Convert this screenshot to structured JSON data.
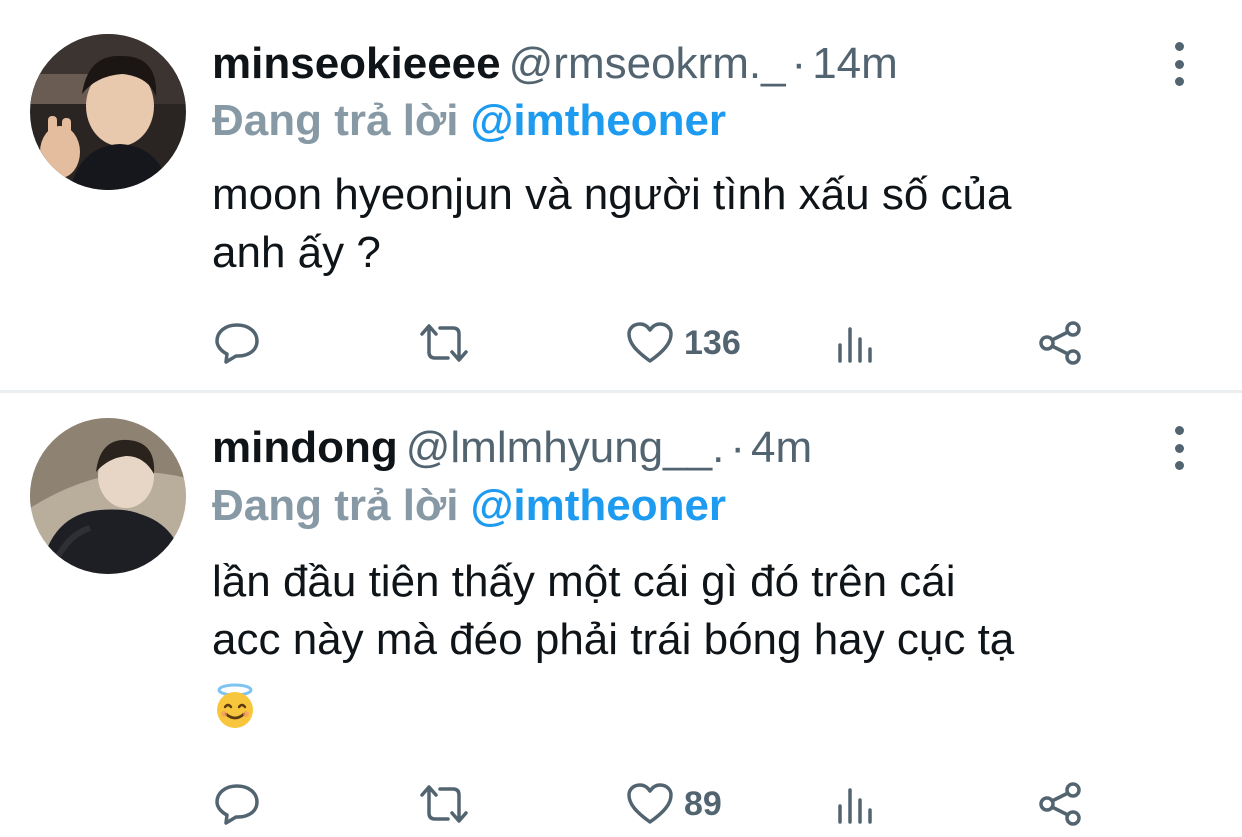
{
  "tweets": [
    {
      "display_name": "minseokieeee",
      "handle": "@rmseokrm._",
      "separator": "·",
      "time": "14m",
      "reply_label": "Đang trả lời",
      "reply_mention": "@imtheoner",
      "text": "moon hyeonjun và người tình xấu số của\nanh ấy ?",
      "like_count": "136",
      "emoji": ""
    },
    {
      "display_name": "mindong",
      "handle": "@lmlmhyung__.",
      "separator": "·",
      "time": "4m",
      "reply_label": "Đang trả lời",
      "reply_mention": "@imtheoner",
      "text": "lần đầu tiên thấy một cái gì đó trên cái\nacc này mà đéo phải trái bóng hay cục tạ",
      "like_count": "89",
      "emoji": "smiling-face-with-halo"
    }
  ],
  "colors": {
    "text_primary": "#0f1419",
    "text_secondary": "#536471",
    "reply_label": "#8899a6",
    "mention": "#1d9bf0",
    "divider": "#eceff1"
  },
  "icons": [
    "reply-icon",
    "retweet-icon",
    "like-icon",
    "views-icon",
    "share-icon",
    "more-icon"
  ]
}
